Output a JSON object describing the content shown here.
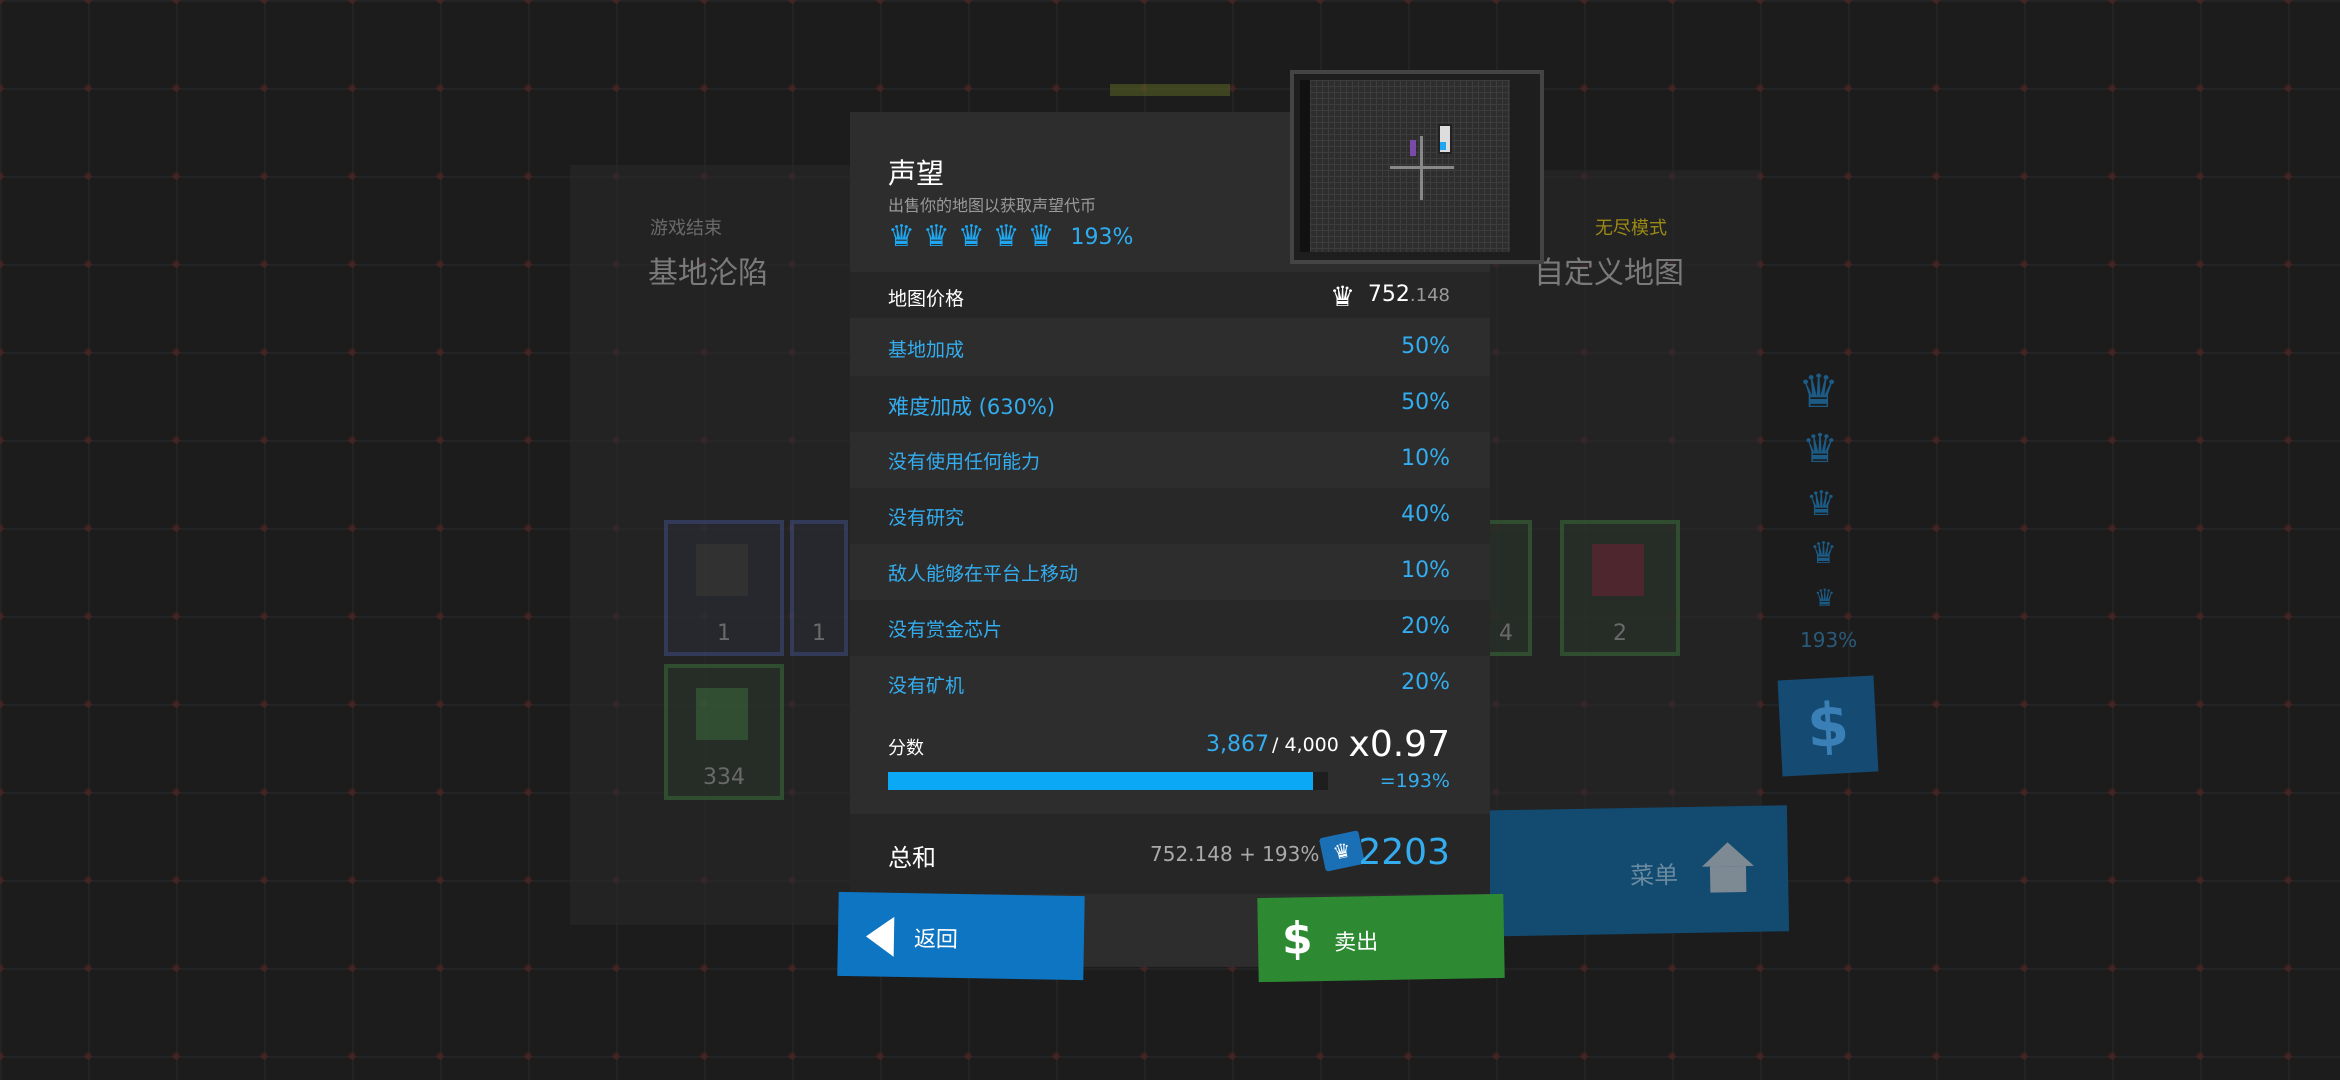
{
  "background": {
    "left_panel": {
      "subtitle": "游戏结束",
      "title": "基地沦陷"
    },
    "right_panel": {
      "subtitle": "无尽模式",
      "title": "自定义地图"
    },
    "left_cards": [
      "1",
      "1",
      "334"
    ],
    "right_cards": [
      "4",
      "2"
    ],
    "crown_pct": "193%",
    "menu_label": "菜单"
  },
  "dialog": {
    "title": "声望",
    "subtitle": "出售你的地图以获取声望代币",
    "crown_count": 5,
    "crown_pct": "193%",
    "price": {
      "label": "地图价格",
      "value": "752",
      "decimal": ".148"
    },
    "bonuses": [
      {
        "label": "基地加成",
        "value": "50%"
      },
      {
        "label": "难度加成 (630%)",
        "value": "50%"
      },
      {
        "label": "没有使用任何能力",
        "value": "10%"
      },
      {
        "label": "没有研究",
        "value": "40%"
      },
      {
        "label": "敌人能够在平台上移动",
        "value": "10%"
      },
      {
        "label": "没有赏金芯片",
        "value": "20%"
      },
      {
        "label": "没有矿机",
        "value": "20%"
      }
    ],
    "score": {
      "label": "分数",
      "current": "3,867",
      "max": "/ 4,000",
      "progress": 0.9668,
      "multiplier": "x0.97",
      "multiplier_pct": "=193%"
    },
    "total": {
      "label": "总和",
      "formula": "752.148 + 193% =",
      "value": "2203"
    },
    "back_label": "返回",
    "sell_label": "卖出"
  },
  "colors": {
    "accent_blue": "#33adef",
    "bar_blue": "#0aa8f5",
    "back_button": "#0e75c2",
    "sell_button": "#2d8a32",
    "endless_yellow": "#9c8a16"
  }
}
